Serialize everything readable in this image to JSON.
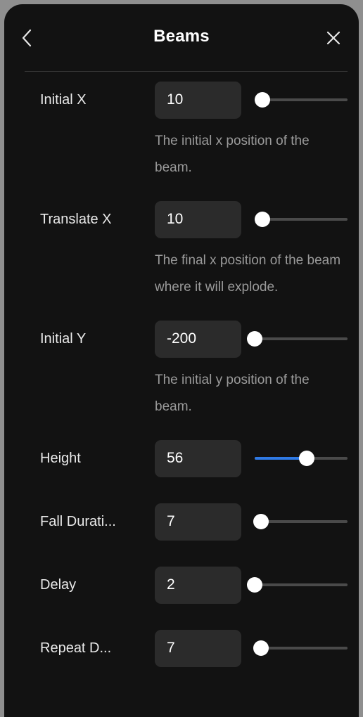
{
  "header": {
    "title": "Beams",
    "back_icon": "chevron-left-icon",
    "close_icon": "close-icon"
  },
  "colors": {
    "panel_bg": "#121212",
    "input_bg": "#2b2b2b",
    "accent": "#2f7ae5",
    "track": "#4a4a4a",
    "thumb": "#ffffff",
    "label_text": "#e9e9e9",
    "desc_text": "#9a9a9a"
  },
  "controls": [
    {
      "label": "Initial X",
      "value": "10",
      "slider_percent": 8,
      "fill_percent": 5,
      "description": "The initial x position of the beam."
    },
    {
      "label": "Translate X",
      "value": "10",
      "slider_percent": 8,
      "fill_percent": 5,
      "description": "The final x position of the beam where it will explode."
    },
    {
      "label": "Initial Y",
      "value": "-200",
      "slider_percent": 0,
      "fill_percent": 0,
      "description": "The initial y position of the beam."
    },
    {
      "label": "Height",
      "value": "56",
      "slider_percent": 56,
      "fill_percent": 56,
      "description": ""
    },
    {
      "label": "Fall Durati...",
      "value": "7",
      "slider_percent": 7,
      "fill_percent": 4,
      "description": ""
    },
    {
      "label": "Delay",
      "value": "2",
      "slider_percent": 0,
      "fill_percent": 0,
      "description": ""
    },
    {
      "label": "Repeat D...",
      "value": "7",
      "slider_percent": 7,
      "fill_percent": 4,
      "description": ""
    }
  ]
}
